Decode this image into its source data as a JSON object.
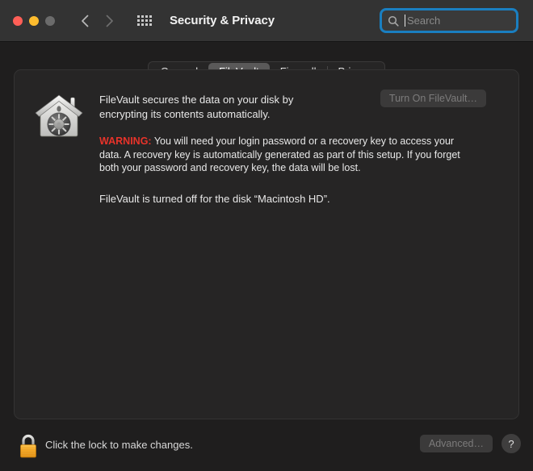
{
  "window": {
    "title": "Security & Privacy"
  },
  "toolbar": {
    "back_icon": "chevron-left-icon",
    "forward_icon": "chevron-right-icon",
    "grid_icon": "show-all-grid-icon",
    "traffic_lights": [
      "close",
      "minimize",
      "zoom"
    ],
    "search": {
      "placeholder": "Search",
      "value": "",
      "icon": "search-icon",
      "focused": true,
      "focus_color": "#1a7fc1"
    }
  },
  "tabs": [
    {
      "label": "General",
      "selected": false
    },
    {
      "label": "FileVault",
      "selected": true
    },
    {
      "label": "Firewall",
      "selected": false
    },
    {
      "label": "Privacy",
      "selected": false
    }
  ],
  "main": {
    "icon": "filevault-house-safe-icon",
    "lead_line1": "FileVault secures the data on your disk by",
    "lead_line2": "encrypting its contents automatically.",
    "warning_label": "WARNING:",
    "warning_text": " You will need your login password or a recovery key to access your data. A recovery key is automatically generated as part of this setup. If you forget both your password and recovery key, the data will be lost.",
    "warning_color": "#e8332a",
    "status": "FileVault is turned off for the disk “Macintosh HD”.",
    "turn_on_button": {
      "label": "Turn On FileVault…",
      "enabled": false
    }
  },
  "bottom": {
    "lock_icon": "closed-padlock-icon",
    "lock_state": "locked",
    "lock_color": "#f6a623",
    "lock_text": "Click the lock to make changes.",
    "advanced_button": {
      "label": "Advanced…",
      "enabled": false
    },
    "help_button": {
      "label": "?"
    }
  }
}
